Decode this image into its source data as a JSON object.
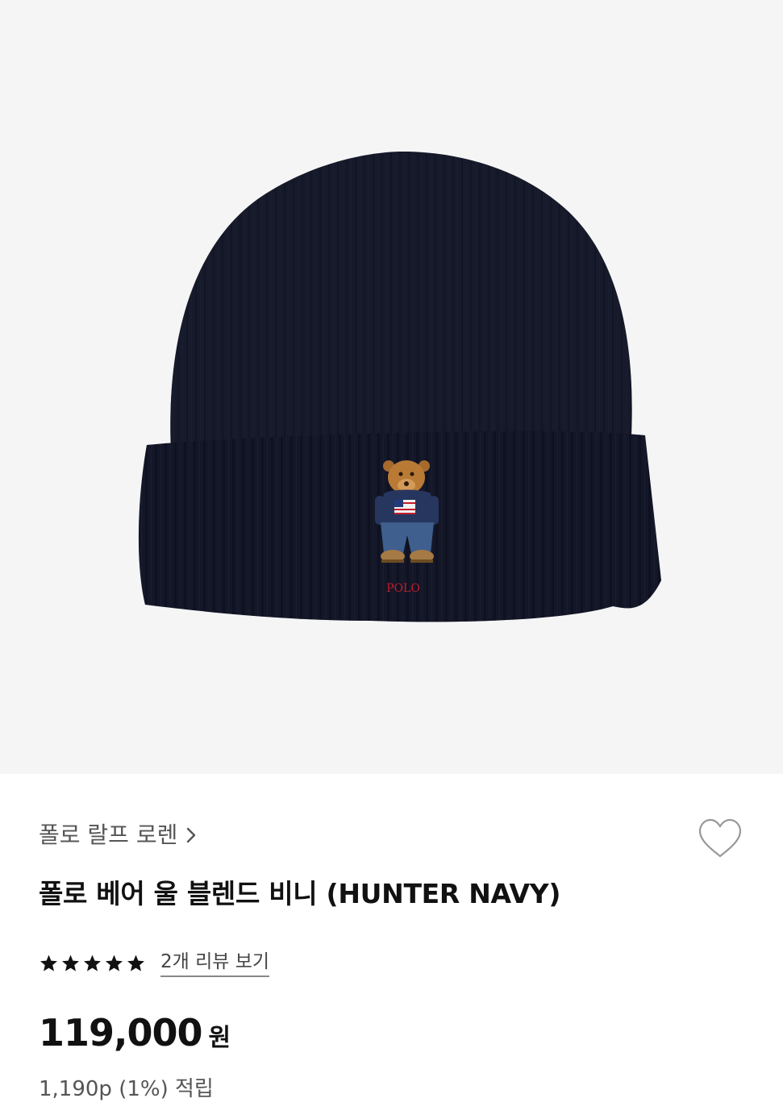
{
  "product_image": {
    "alt": "폴로 베어 울 블렌드 비니 (HUNTER NAVY)",
    "logo_text": "POLO",
    "colors": {
      "background": "#f5f5f5",
      "beanie": "#161a2b",
      "logo": "#c41e2b"
    }
  },
  "product": {
    "brand": "폴로 랄프 로렌",
    "name": "폴로 베어 울 블렌드 비니 (HUNTER NAVY)",
    "rating_stars": 5,
    "review_link": "2개 리뷰 보기",
    "price": "119,000",
    "price_unit": "원",
    "points": "1,190p (1%) 적립"
  },
  "icons": {
    "wishlist": "heart-outline-icon",
    "brand_chevron": "chevron-right-icon",
    "star": "star-icon"
  }
}
